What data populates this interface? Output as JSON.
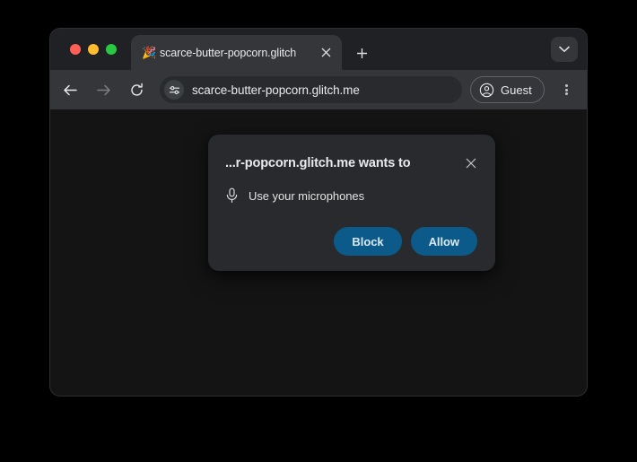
{
  "window": {
    "traffic_lights": [
      {
        "name": "close",
        "color": "#ff5f57"
      },
      {
        "name": "minimize",
        "color": "#febc2e"
      },
      {
        "name": "maximize",
        "color": "#28c840"
      }
    ]
  },
  "tab_strip": {
    "tab": {
      "favicon": "🎉",
      "favicon_name": "party-popper-favicon",
      "title": "scarce-butter-popcorn.glitch",
      "close_icon": "close-icon"
    },
    "new_tab_icon": "plus-icon",
    "tab_list_icon": "chevron-down-icon"
  },
  "toolbar": {
    "back_icon": "back-arrow-icon",
    "forward_icon": "forward-arrow-icon",
    "reload_icon": "reload-icon",
    "site_settings_icon": "tune-sliders-icon",
    "url": "scarce-butter-popcorn.glitch.me",
    "profile": {
      "icon": "account-circle-icon",
      "label": "Guest"
    },
    "menu_icon": "three-dot-menu-icon"
  },
  "permission_dialog": {
    "title": "...r-popcorn.glitch.me wants to",
    "close_icon": "close-icon",
    "permission": {
      "icon": "microphone-icon",
      "text": "Use your microphones"
    },
    "buttons": {
      "block": "Block",
      "allow": "Allow"
    },
    "accent_color": "#0b5a8a"
  },
  "page": {
    "background_color": "#141414"
  }
}
